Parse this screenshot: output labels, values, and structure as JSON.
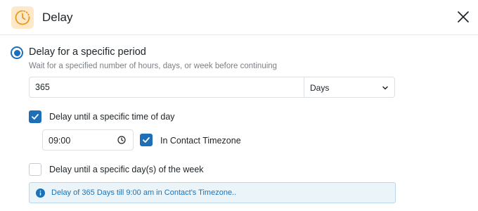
{
  "header": {
    "title": "Delay",
    "icon": "clock-icon",
    "close_icon": "close-icon"
  },
  "option": {
    "label": "Delay for a specific period",
    "description": "Wait for a specified number of hours, days, or week before continuing",
    "selected": true
  },
  "duration": {
    "value": "365",
    "unit": "Days"
  },
  "time_of_day": {
    "label": "Delay until a specific time of day",
    "checked": true,
    "time": "09:00",
    "timezone_label": "In Contact Timezone",
    "timezone_checked": true
  },
  "day_of_week": {
    "label": "Delay until a specific day(s) of the week",
    "checked": false
  },
  "info": {
    "text": "Delay of 365 Days till 9:00 am in Contact's Timezone..",
    "icon": "info-icon"
  },
  "colors": {
    "accent": "#1d6fb8",
    "icon_bg": "#fde9c8",
    "icon_fg": "#e89a1c",
    "info_bg": "#eaf4f9",
    "info_text": "#1a73b8"
  }
}
